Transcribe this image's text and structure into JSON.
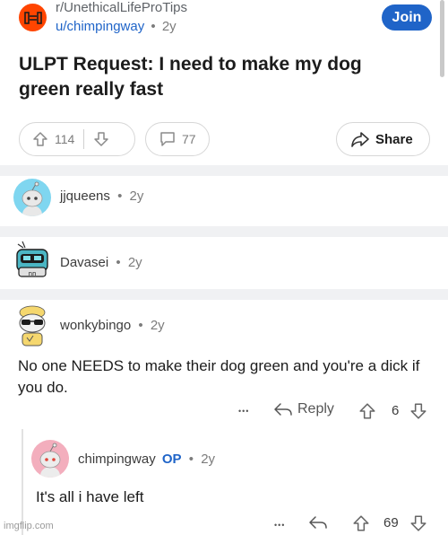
{
  "post": {
    "subreddit": "r/UnethicalLifeProTips",
    "author": "u/chimpingway",
    "age": "2y",
    "join_label": "Join",
    "title": "ULPT Request: I need to make my dog green really fast",
    "upvotes": "114",
    "comments": "77",
    "share_label": "Share"
  },
  "comments": [
    {
      "author": "jjqueens",
      "age": "2y"
    },
    {
      "author": "Davasei",
      "age": "2y"
    },
    {
      "author": "wonkybingo",
      "age": "2y",
      "body": "No one NEEDS to make their dog green and you're a dick if you do.",
      "reply_label": "Reply",
      "votes": "6"
    }
  ],
  "reply": {
    "author": "chimpingway",
    "op_badge": "OP",
    "age": "2y",
    "body": "It's all i have left",
    "votes": "69"
  },
  "ui": {
    "dots": "•••",
    "separator": "•",
    "watermark": "imgflip.com"
  },
  "colors": {
    "join_bg": "#1f64c8",
    "subreddit_icon": "#ff4500",
    "divider": "#f0f1f3"
  }
}
